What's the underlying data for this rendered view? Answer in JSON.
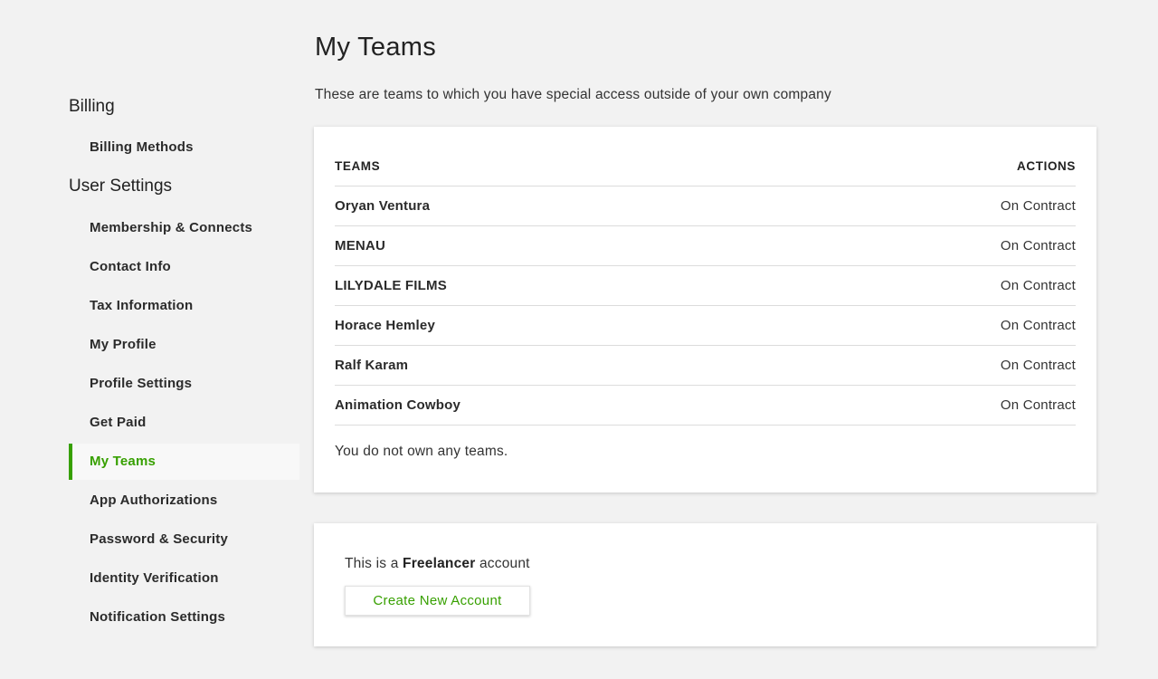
{
  "sidebar": {
    "sections": [
      {
        "title": "Billing",
        "items": [
          "Billing Methods"
        ]
      },
      {
        "title": "User Settings",
        "items": [
          "Membership & Connects",
          "Contact Info",
          "Tax Information",
          "My Profile",
          "Profile Settings",
          "Get Paid",
          "My Teams",
          "App Authorizations",
          "Password & Security",
          "Identity Verification",
          "Notification Settings"
        ]
      }
    ],
    "active_item": "My Teams"
  },
  "main": {
    "title": "My Teams",
    "subtitle": "These are teams to which you have special access outside of your own company",
    "table": {
      "columns": [
        "TEAMS",
        "ACTIONS"
      ],
      "rows": [
        {
          "team": "Oryan Ventura",
          "action": "On Contract"
        },
        {
          "team": "MENAU",
          "action": "On Contract"
        },
        {
          "team": "LILYDALE FILMS",
          "action": "On Contract"
        },
        {
          "team": "Horace Hemley",
          "action": "On Contract"
        },
        {
          "team": "Ralf Karam",
          "action": "On Contract"
        },
        {
          "team": "Animation Cowboy",
          "action": "On Contract"
        }
      ]
    },
    "no_teams_note": "You do not own any teams."
  },
  "account": {
    "prefix": "This is a",
    "type": "Freelancer",
    "suffix": "account",
    "create_button": "Create New Account"
  },
  "colors": {
    "accent": "#37a000",
    "background": "#f2f2f2",
    "card": "#ffffff"
  }
}
